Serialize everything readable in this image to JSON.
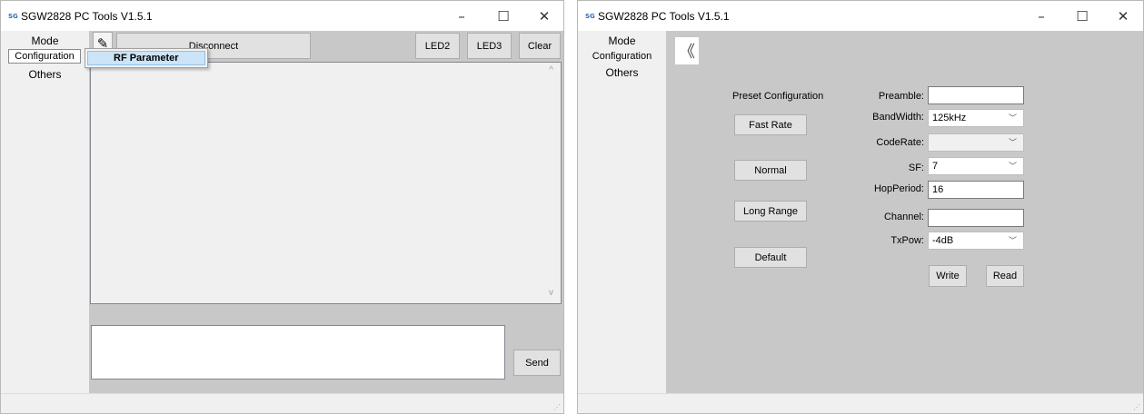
{
  "app": {
    "title": "SGW2828 PC Tools V1.5.1",
    "icon_text": "SG",
    "minimize_glyph": "–",
    "maximize_glyph": "☐",
    "close_glyph": "✕",
    "grip_glyph": "⋰"
  },
  "mode_panel": {
    "items": [
      "Mode",
      "Configuration",
      "Others"
    ]
  },
  "left_window": {
    "toolbar": {
      "pencil_glyph": "✎",
      "disconnect_label": "Disconnect",
      "led2_label": "LED2",
      "led3_label": "LED3",
      "clear_label": "Clear"
    },
    "context_menu": {
      "item_label": "RF Parameter"
    },
    "log_output": {
      "scroll_up_glyph": "^",
      "scroll_down_glyph": "v"
    },
    "send_input": {
      "value": ""
    },
    "send_label": "Send"
  },
  "right_window": {
    "back_glyph": "《",
    "preset": {
      "title": "Preset Configuration",
      "buttons": [
        "Fast Rate",
        "Normal",
        "Long Range",
        "Default"
      ]
    },
    "fields": {
      "preamble_label": "Preamble:",
      "preamble_value": "",
      "bandwidth_label": "BandWidth:",
      "bandwidth_value": "125kHz",
      "coderate_label": "CodeRate:",
      "coderate_value": "",
      "sf_label": "SF:",
      "sf_value": "7",
      "hopperiod_label": "HopPeriod:",
      "hopperiod_value": "16",
      "channel_label": "Channel:",
      "channel_value": "",
      "txpow_label": "TxPow:",
      "txpow_value": "-4dB",
      "dropdown_glyph": "﹀"
    },
    "write_label": "Write",
    "read_label": "Read"
  },
  "colors": {
    "content_bg": "#c8c8c8",
    "panel_bg": "#f0f0f0",
    "button_bg": "#e1e1e1",
    "menu_highlight": "#cce4f7"
  }
}
